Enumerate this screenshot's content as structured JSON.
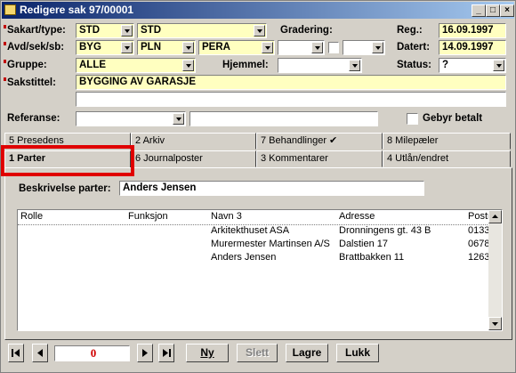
{
  "window": {
    "title": "Redigere sak 97/00001"
  },
  "form": {
    "sakart_label": "Sakart/type:",
    "sakart_value": "STD",
    "type_value": "STD",
    "gradering_label": "Gradering:",
    "reg_label": "Reg.:",
    "reg_value": "16.09.1997",
    "avd_label": "Avd/sek/sb:",
    "avd_value": "BYG",
    "sek_value": "PLN",
    "sb_value": "PERA",
    "datert_label": "Datert:",
    "datert_value": "14.09.1997",
    "gruppe_label": "Gruppe:",
    "gruppe_value": "ALLE",
    "hjemmel_label": "Hjemmel:",
    "status_label": "Status:",
    "status_value": "?",
    "sakstittel_label": "Sakstittel:",
    "sakstittel_value": "BYGGING AV GARASJE",
    "referanse_label": "Referanse:",
    "gebyr_label": "Gebyr betalt"
  },
  "tabs_row1": [
    "5 Presedens",
    "2 Arkiv",
    "7 Behandlinger ✔",
    "8 Milepæler"
  ],
  "tabs_row2": [
    "1 Parter",
    "6 Journalposter",
    "3 Kommentarer",
    "4 Utlån/endret"
  ],
  "parter": {
    "beskrivelse_label": "Beskrivelse parter:",
    "beskrivelse_value": "Anders Jensen",
    "columns": [
      "Rolle",
      "Funksjon",
      "Navn 3",
      "Adresse",
      "Postnr."
    ],
    "rows": [
      [
        "",
        "",
        "Arkitekthuset ASA",
        "Dronningens gt. 43 B",
        "0133"
      ],
      [
        "",
        "",
        "Murermester Martinsen A/S",
        "Dalstien 17",
        "0678"
      ],
      [
        "",
        "",
        "Anders Jensen",
        "Brattbakken 11",
        "1263"
      ]
    ]
  },
  "nav": {
    "record_value": "0",
    "ny_label": "Ny",
    "slett_label": "Slett",
    "lagre_label": "Lagre",
    "lukk_label": "Lukk"
  }
}
